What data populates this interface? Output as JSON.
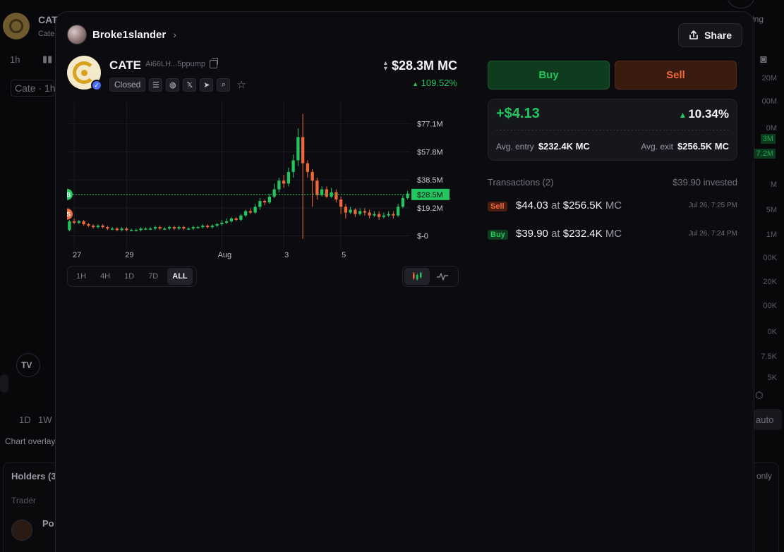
{
  "background": {
    "header_title": "CAT",
    "header_sub": "Cate",
    "timeframe": "1h",
    "chart_label": "Cate · 1h",
    "bottom_timeframes": [
      "1D",
      "1W"
    ],
    "chart_overlay_label": "Chart overlay",
    "holders_label": "Holders (3",
    "trader_label": "Trader",
    "trader_name": "Po",
    "right_scale": [
      "ing",
      "20M",
      "00M",
      "0M",
      "3M",
      "7.2M",
      "M",
      "5M",
      "1M",
      "00K",
      "20K",
      "00K",
      "0K",
      "7.5K",
      "5K"
    ],
    "auto_label": "auto",
    "only_label": "only"
  },
  "modal": {
    "user": {
      "name": "Broke1slander"
    },
    "share_label": "Share",
    "token": {
      "name": "CATE",
      "address": "Ai66LH...5ppump",
      "status": "Closed",
      "market_cap": "$28.3M MC",
      "change": "109.52%",
      "change_arrow": "▲"
    },
    "timeframes": [
      "1H",
      "4H",
      "1D",
      "7D",
      "ALL"
    ],
    "active_timeframe": "ALL",
    "trade": {
      "buy_label": "Buy",
      "sell_label": "Sell"
    },
    "pnl": {
      "value": "+$4.13",
      "percent": "10.34%",
      "avg_entry_label": "Avg. entry",
      "avg_entry_value": "$232.4K MC",
      "avg_exit_label": "Avg. exit",
      "avg_exit_value": "$256.5K MC"
    },
    "transactions": {
      "title": "Transactions (2)",
      "invested": "$39.90 invested",
      "items": [
        {
          "type": "Sell",
          "amount": "$44.03",
          "at": "at",
          "mc": "$256.5K",
          "mc_unit": "MC",
          "time": "Jul 26, 7:25 PM"
        },
        {
          "type": "Buy",
          "amount": "$39.90",
          "at": "at",
          "mc": "$232.4K",
          "mc_unit": "MC",
          "time": "Jul 26, 7:24 PM"
        }
      ]
    },
    "colors": {
      "up": "#22c55e",
      "down": "#f0683a",
      "price_line": "#22c55e"
    }
  },
  "chart_data": {
    "type": "candlestick",
    "x_tick_labels": [
      "27",
      "29",
      "Aug",
      "3",
      "5"
    ],
    "y_tick_labels": [
      "$77.1M",
      "$57.8M",
      "$38.5M",
      "$19.2M",
      "$-0"
    ],
    "y_ticks": [
      77.1,
      57.8,
      38.5,
      19.2,
      0
    ],
    "ylim": [
      -8,
      92
    ],
    "current_price_label": "$28.5M",
    "current_price": 28.5,
    "markers": [
      {
        "label": "B",
        "value": 28.5,
        "color": "#22c55e"
      },
      {
        "label": "S",
        "value": 15.0,
        "color": "#f0683a"
      }
    ],
    "candles": [
      [
        4,
        10,
        11,
        3
      ],
      [
        10,
        9,
        12,
        8
      ],
      [
        9,
        10,
        11,
        8
      ],
      [
        10,
        8,
        11,
        7
      ],
      [
        8,
        7,
        9,
        6
      ],
      [
        7,
        6,
        8,
        5
      ],
      [
        6,
        7,
        8,
        5
      ],
      [
        7,
        6,
        8,
        5
      ],
      [
        6,
        5,
        7,
        4
      ],
      [
        5,
        5,
        6,
        4
      ],
      [
        5,
        4,
        6,
        3
      ],
      [
        4,
        5,
        6,
        3
      ],
      [
        5,
        4,
        6,
        3
      ],
      [
        4,
        4,
        5,
        3
      ],
      [
        4,
        4,
        5,
        3
      ],
      [
        4,
        5,
        6,
        3
      ],
      [
        5,
        5,
        6,
        4
      ],
      [
        5,
        5,
        6,
        4
      ],
      [
        5,
        6,
        7,
        4
      ],
      [
        6,
        5,
        7,
        4
      ],
      [
        5,
        5,
        6,
        4
      ],
      [
        5,
        6,
        7,
        4
      ],
      [
        6,
        5,
        7,
        4
      ],
      [
        5,
        6,
        7,
        4
      ],
      [
        6,
        5,
        7,
        4
      ],
      [
        5,
        5,
        6,
        4
      ],
      [
        5,
        6,
        7,
        4
      ],
      [
        6,
        6,
        7,
        5
      ],
      [
        6,
        7,
        8,
        5
      ],
      [
        7,
        6,
        8,
        5
      ],
      [
        6,
        7,
        8,
        5
      ],
      [
        7,
        8,
        9,
        6
      ],
      [
        8,
        9,
        11,
        7
      ],
      [
        9,
        10,
        12,
        8
      ],
      [
        10,
        12,
        13,
        9
      ],
      [
        12,
        11,
        13,
        10
      ],
      [
        11,
        14,
        15,
        10
      ],
      [
        14,
        17,
        18,
        13
      ],
      [
        17,
        16,
        19,
        15
      ],
      [
        16,
        20,
        22,
        15
      ],
      [
        20,
        24,
        26,
        18
      ],
      [
        24,
        23,
        25,
        21
      ],
      [
        23,
        27,
        29,
        22
      ],
      [
        27,
        32,
        36,
        26
      ],
      [
        32,
        38,
        40,
        30
      ],
      [
        38,
        36,
        42,
        33
      ],
      [
        36,
        44,
        47,
        34
      ],
      [
        44,
        52,
        56,
        40
      ],
      [
        52,
        68,
        74,
        48
      ],
      [
        68,
        50,
        84,
        -2
      ],
      [
        50,
        44,
        52,
        40
      ],
      [
        44,
        38,
        46,
        20
      ],
      [
        38,
        28,
        40,
        25
      ],
      [
        28,
        32,
        34,
        27
      ],
      [
        32,
        27,
        34,
        26
      ],
      [
        27,
        30,
        33,
        26
      ],
      [
        30,
        25,
        32,
        23
      ],
      [
        25,
        20,
        27,
        15
      ],
      [
        20,
        16,
        22,
        12
      ],
      [
        16,
        18,
        20,
        15
      ],
      [
        18,
        15,
        19,
        13
      ],
      [
        15,
        17,
        19,
        14
      ],
      [
        17,
        16,
        19,
        14
      ],
      [
        16,
        14,
        18,
        12
      ],
      [
        14,
        15,
        17,
        13
      ],
      [
        15,
        13,
        17,
        11
      ],
      [
        13,
        14,
        16,
        12
      ],
      [
        14,
        15,
        17,
        13
      ],
      [
        15,
        14,
        17,
        12
      ],
      [
        14,
        20,
        22,
        13
      ],
      [
        20,
        26,
        28,
        19
      ],
      [
        26,
        29,
        31,
        25
      ]
    ]
  }
}
